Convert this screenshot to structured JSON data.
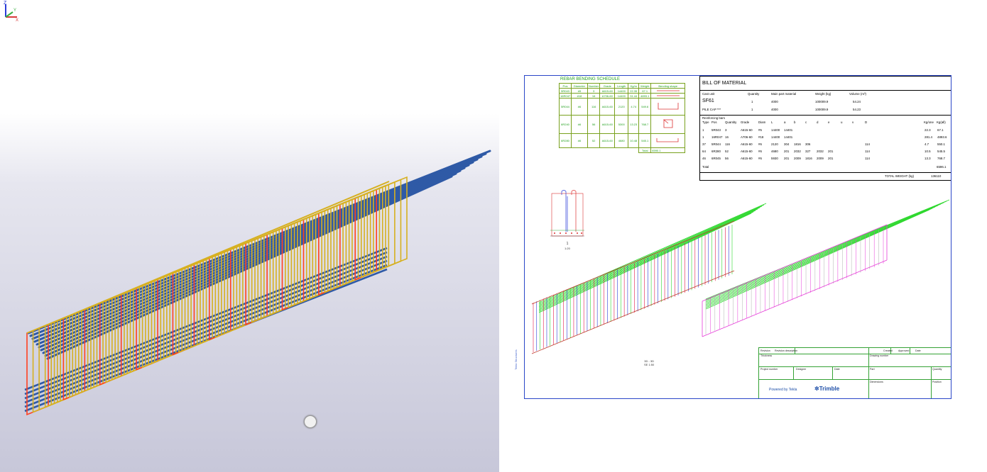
{
  "viewport_3d": {
    "axis_z_label": "Z",
    "axis_x_label": "X",
    "axis_y_label": "Y",
    "colors": {
      "bar": "#2f5aa6",
      "stirrup": "#d6b020",
      "accent": "#ff4020"
    }
  },
  "drawing": {
    "side_label": "Tekla Structures",
    "rebar_schedule": {
      "title": "REBAR BENDING SCHEDULE",
      "columns": [
        "Pos",
        "Diameter",
        "Number",
        "Grade",
        "Length",
        "Kg/m",
        "Weight",
        "Bending shape"
      ],
      "rows": [
        [
          "5R043",
          "#5",
          "3",
          "A615-60",
          "14400",
          "22.35",
          "67.1",
          ""
        ],
        [
          "16R047",
          "#18",
          "16",
          "A706-60",
          "14400",
          "31.44",
          "4893.1",
          ""
        ],
        [
          "5R044",
          "#6",
          "116",
          "A615-60",
          "2120",
          "4.74",
          "549.6",
          ""
        ],
        [
          "6R240",
          "#6",
          "56",
          "A615-60",
          "5300",
          "13.23",
          "768.7",
          ""
        ],
        [
          "6R280",
          "#6",
          "52",
          "A615-60",
          "4680",
          "10.48",
          "545.1",
          ""
        ]
      ],
      "total_label": "Total",
      "total_value": "6590.1"
    },
    "bom": {
      "title": "BILL OF MATERIAL",
      "head_cols": [
        "Cast unit",
        "Quantity",
        "Main part material",
        "Weight (kg)",
        "Volume (m³)"
      ],
      "row1": [
        "SF61",
        "1",
        "4000",
        "100009.9",
        "54.24"
      ],
      "row2": [
        "PILE CAP ***",
        "1",
        "4000",
        "100009.9",
        "54.23"
      ],
      "reinf_label": "Reinforcing bars",
      "reinf_cols": [
        "Type",
        "Pos",
        "Quantity",
        "Grade",
        "Diam",
        "L",
        "a",
        "b",
        "c",
        "d",
        "e",
        "u",
        "v",
        "D",
        "Kg/one",
        "Kg(all)"
      ],
      "reinf_rows": [
        [
          "1",
          "5R043",
          "3",
          "A615-60",
          "#5",
          "14400",
          "14401",
          "",
          "",
          "",
          "",
          "",
          "",
          "",
          "22.3",
          "67.1"
        ],
        [
          "1",
          "16R047",
          "16",
          "A706-60",
          "#18",
          "14400",
          "14401",
          "",
          "",
          "",
          "",
          "",
          "",
          "",
          "281.4",
          "4893.6"
        ],
        [
          "37",
          "5R044",
          "116",
          "A615-60",
          "#6",
          "2120",
          "304",
          "1816",
          "306",
          "",
          "",
          "",
          "",
          "114",
          "4.7",
          "550.1"
        ],
        [
          "64",
          "6R280",
          "52",
          "A615-60",
          "#6",
          "4680",
          "201",
          "2032",
          "327",
          "2032",
          "201",
          "",
          "",
          "114",
          "10.5",
          "545.5"
        ],
        [
          "46",
          "6R045",
          "56",
          "A615-60",
          "#6",
          "5930",
          "201",
          "2009",
          "1816",
          "2009",
          "201",
          "",
          "",
          "114",
          "13.3",
          "768.7"
        ]
      ],
      "total_label": "Total",
      "total_value": "6596.1",
      "total_weight_label": "TOTAL WEIGHT (kg)",
      "total_weight_value": "136110"
    },
    "section": {
      "label": "1",
      "scale": "1:20"
    },
    "view_label": {
      "line1": "3D - 3D",
      "line2": "SE 1:50"
    },
    "title_block": {
      "cells": [
        "Revision",
        "Revision description",
        "Created",
        "Approved",
        "Date",
        "Thickness",
        "Drawing number",
        "Project number",
        "Designer",
        "Date",
        "Part",
        "Quantity",
        "Dimensions",
        "Position"
      ],
      "powered": "Powered by Tekla",
      "brand": "Trimble"
    }
  }
}
